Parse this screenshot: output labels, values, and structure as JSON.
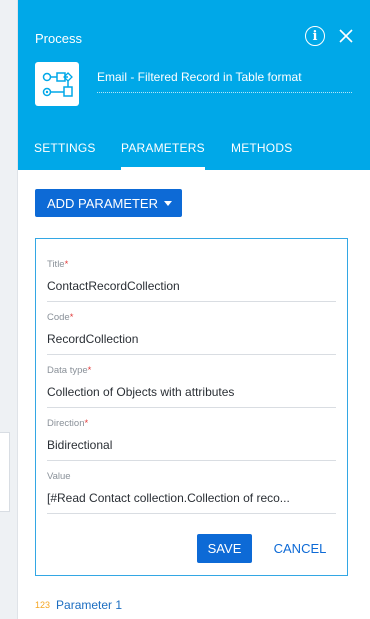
{
  "header": {
    "title": "Process",
    "info_glyph": "i",
    "process_name": "Email - Filtered Record in Table format",
    "process_icon": "process-flow-icon",
    "background_color": "#00a8e8"
  },
  "tabs": [
    {
      "label": "SETTINGS",
      "active": false
    },
    {
      "label": "PARAMETERS",
      "active": true
    },
    {
      "label": "METHODS",
      "active": false
    }
  ],
  "add_parameter_label": "ADD PARAMETER",
  "form": {
    "fields": [
      {
        "label": "Title",
        "required": true,
        "value": "ContactRecordCollection"
      },
      {
        "label": "Code",
        "required": true,
        "value": "RecordCollection"
      },
      {
        "label": "Data type",
        "required": true,
        "value": "Collection of Objects with attributes"
      },
      {
        "label": "Direction",
        "required": true,
        "value": "Bidirectional"
      },
      {
        "label": "Value",
        "required": false,
        "value": "[#Read Contact collection.Collection of reco..."
      }
    ],
    "required_mark": "*",
    "save_label": "SAVE",
    "cancel_label": "CANCEL"
  },
  "parameter_list": [
    {
      "type_badge": "123",
      "name": "Parameter 1"
    }
  ],
  "colors": {
    "accent": "#0d6ad6",
    "header": "#00a8e8",
    "required": "#e23b3b",
    "type_badge": "#f5a623"
  }
}
